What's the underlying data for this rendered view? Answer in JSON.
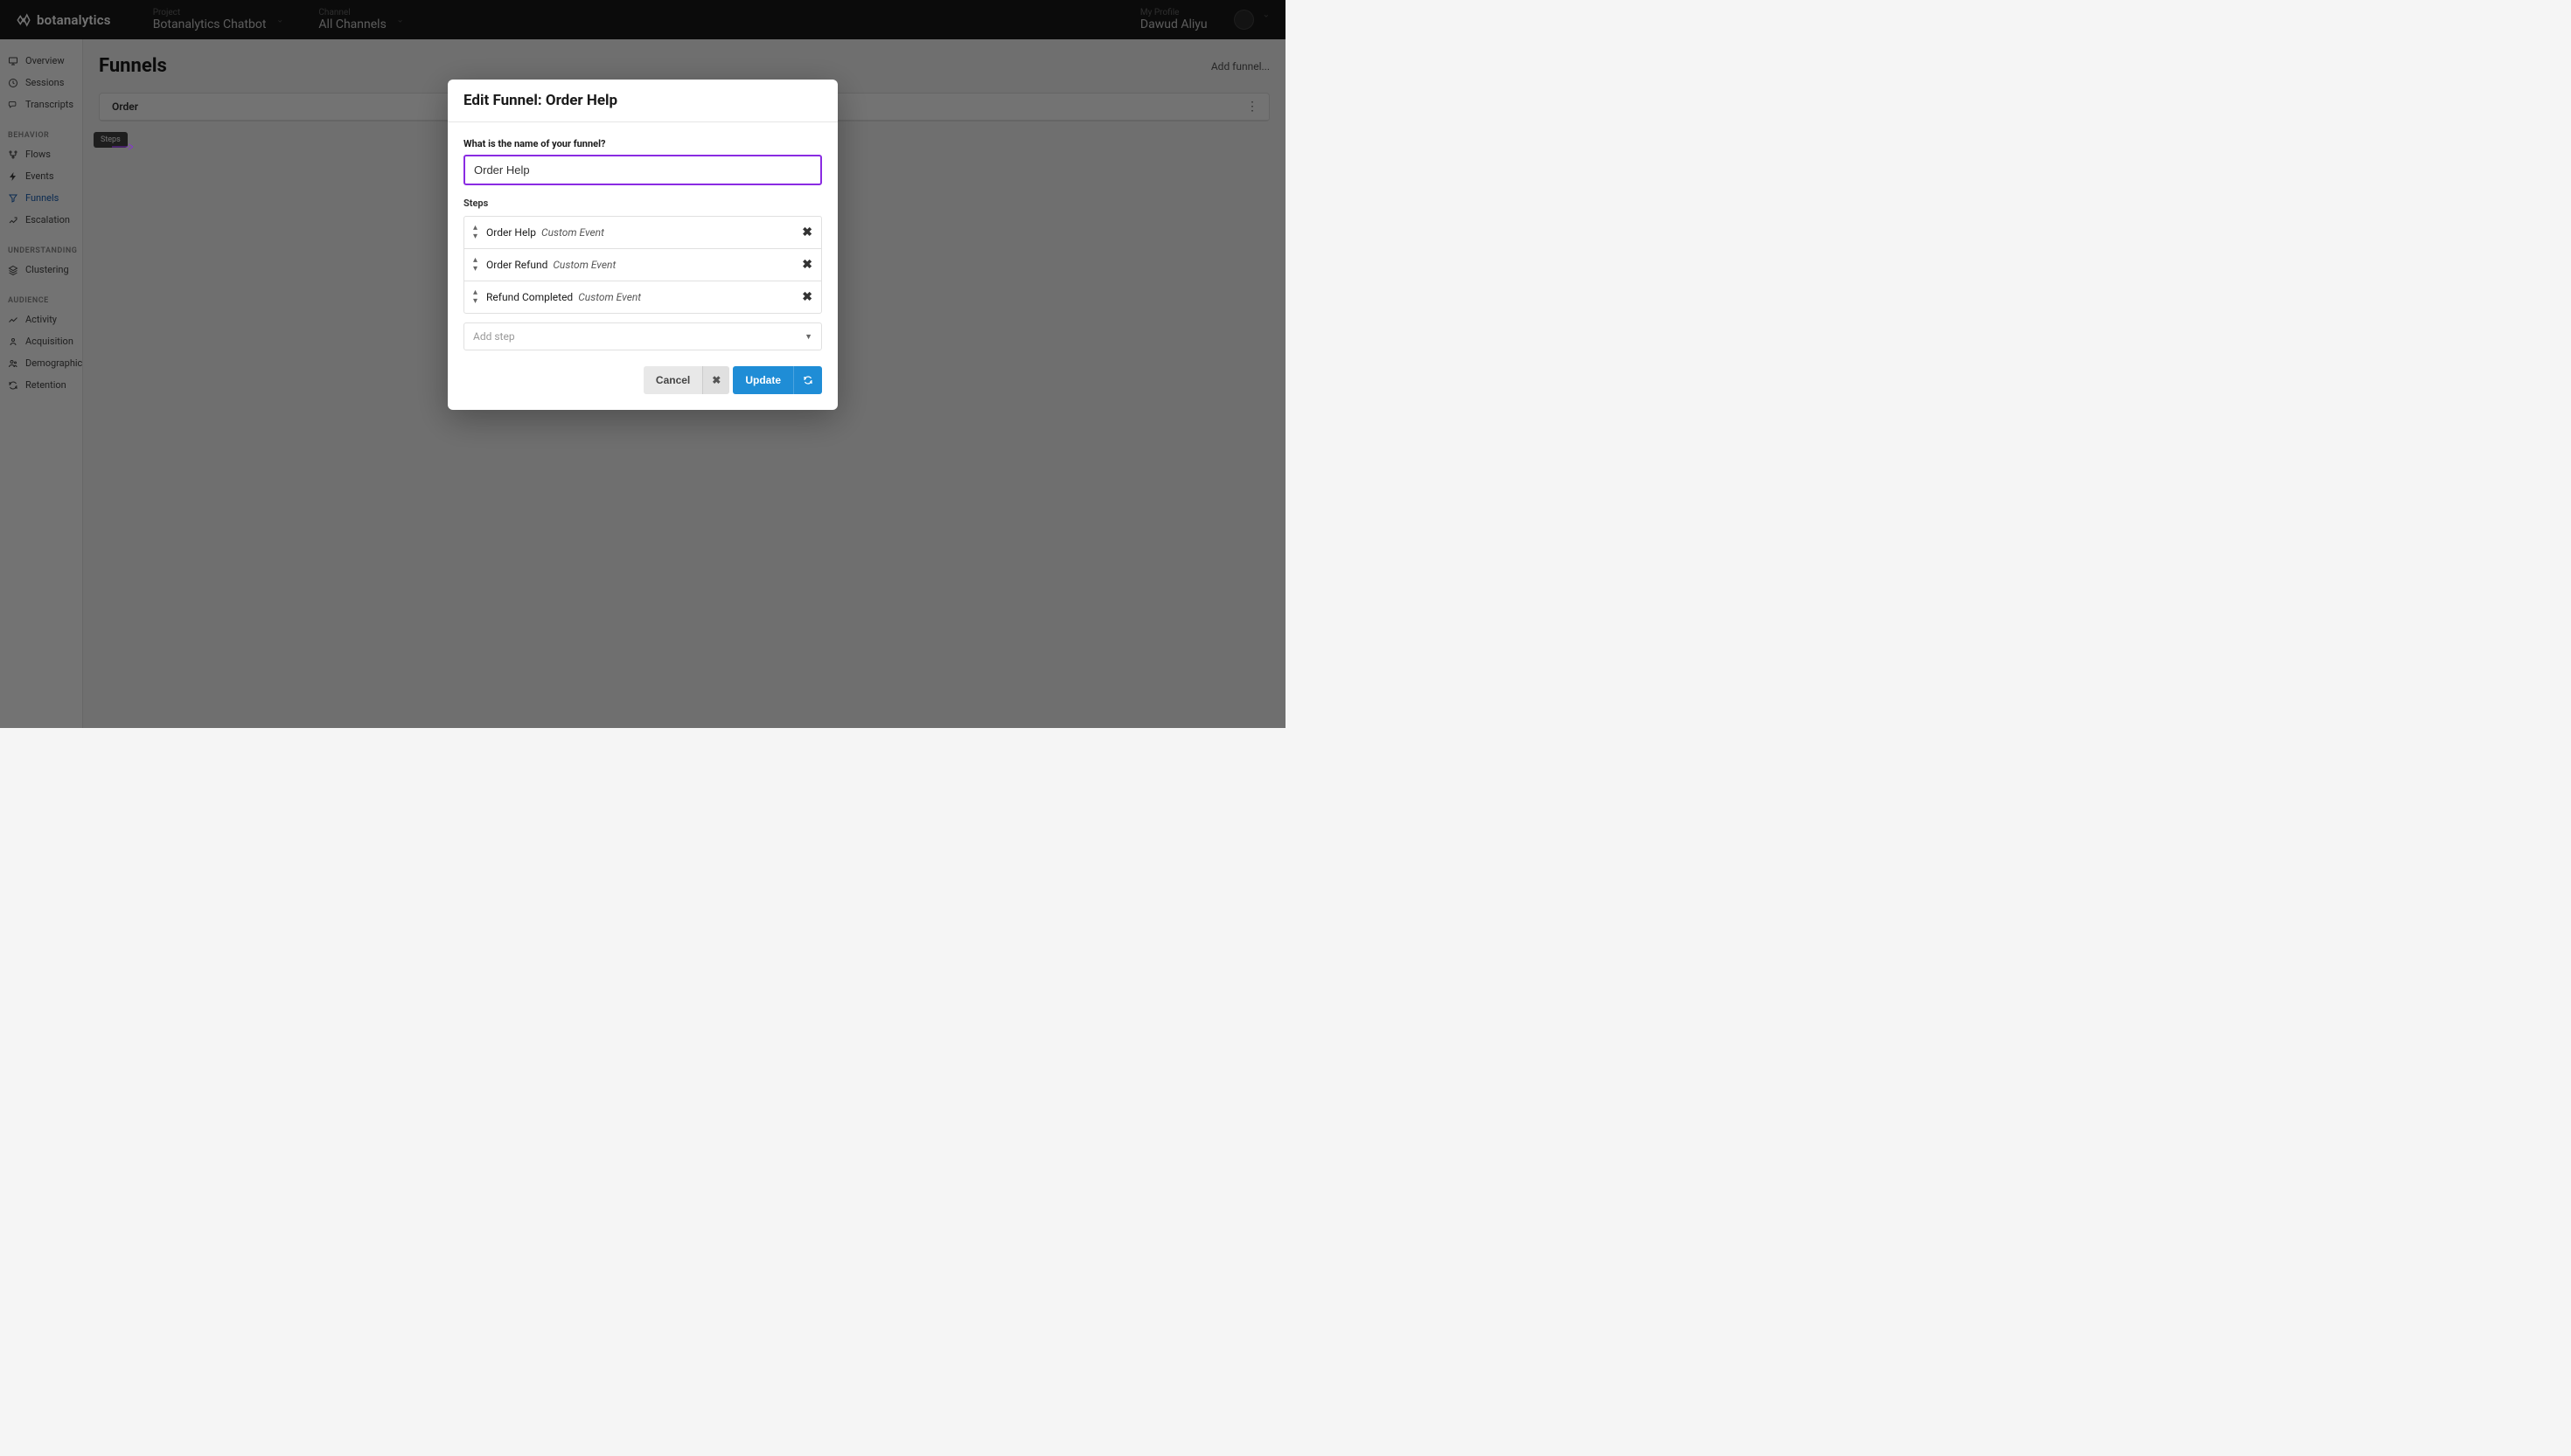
{
  "header": {
    "logo_text": "botanalytics",
    "project_label": "Project",
    "project_value": "Botanalytics Chatbot",
    "channel_label": "Channel",
    "channel_value": "All Channels",
    "profile_label": "My Profile",
    "profile_value": "Dawud Aliyu"
  },
  "sidebar": {
    "items_top": [
      {
        "label": "Overview",
        "icon": "presentation"
      },
      {
        "label": "Sessions",
        "icon": "clock"
      },
      {
        "label": "Transcripts",
        "icon": "chat"
      }
    ],
    "behavior_title": "BEHAVIOR",
    "items_behavior": [
      {
        "label": "Flows",
        "icon": "branch"
      },
      {
        "label": "Events",
        "icon": "bolt"
      },
      {
        "label": "Funnels",
        "icon": "funnel",
        "active": true
      },
      {
        "label": "Escalation",
        "icon": "escalation"
      }
    ],
    "understanding_title": "UNDERSTANDING",
    "items_understanding": [
      {
        "label": "Clustering",
        "icon": "layers"
      }
    ],
    "audience_title": "AUDIENCE",
    "items_audience": [
      {
        "label": "Activity",
        "icon": "trending"
      },
      {
        "label": "Acquisition",
        "icon": "acquisition"
      },
      {
        "label": "Demographics",
        "icon": "people"
      },
      {
        "label": "Retention",
        "icon": "refresh"
      }
    ]
  },
  "main": {
    "page_title": "Funnels",
    "add_funnel": "Add funnel...",
    "funnel_tab": "Order",
    "steps_badge": "Steps"
  },
  "modal": {
    "title": "Edit Funnel: Order Help",
    "name_label": "What is the name of your funnel?",
    "name_value": "Order Help",
    "steps_label": "Steps",
    "steps": [
      {
        "name": "Order Help",
        "type": "Custom Event"
      },
      {
        "name": "Order Refund",
        "type": "Custom Event"
      },
      {
        "name": "Refund Completed",
        "type": "Custom Event"
      }
    ],
    "add_step_placeholder": "Add step",
    "cancel_label": "Cancel",
    "update_label": "Update"
  }
}
